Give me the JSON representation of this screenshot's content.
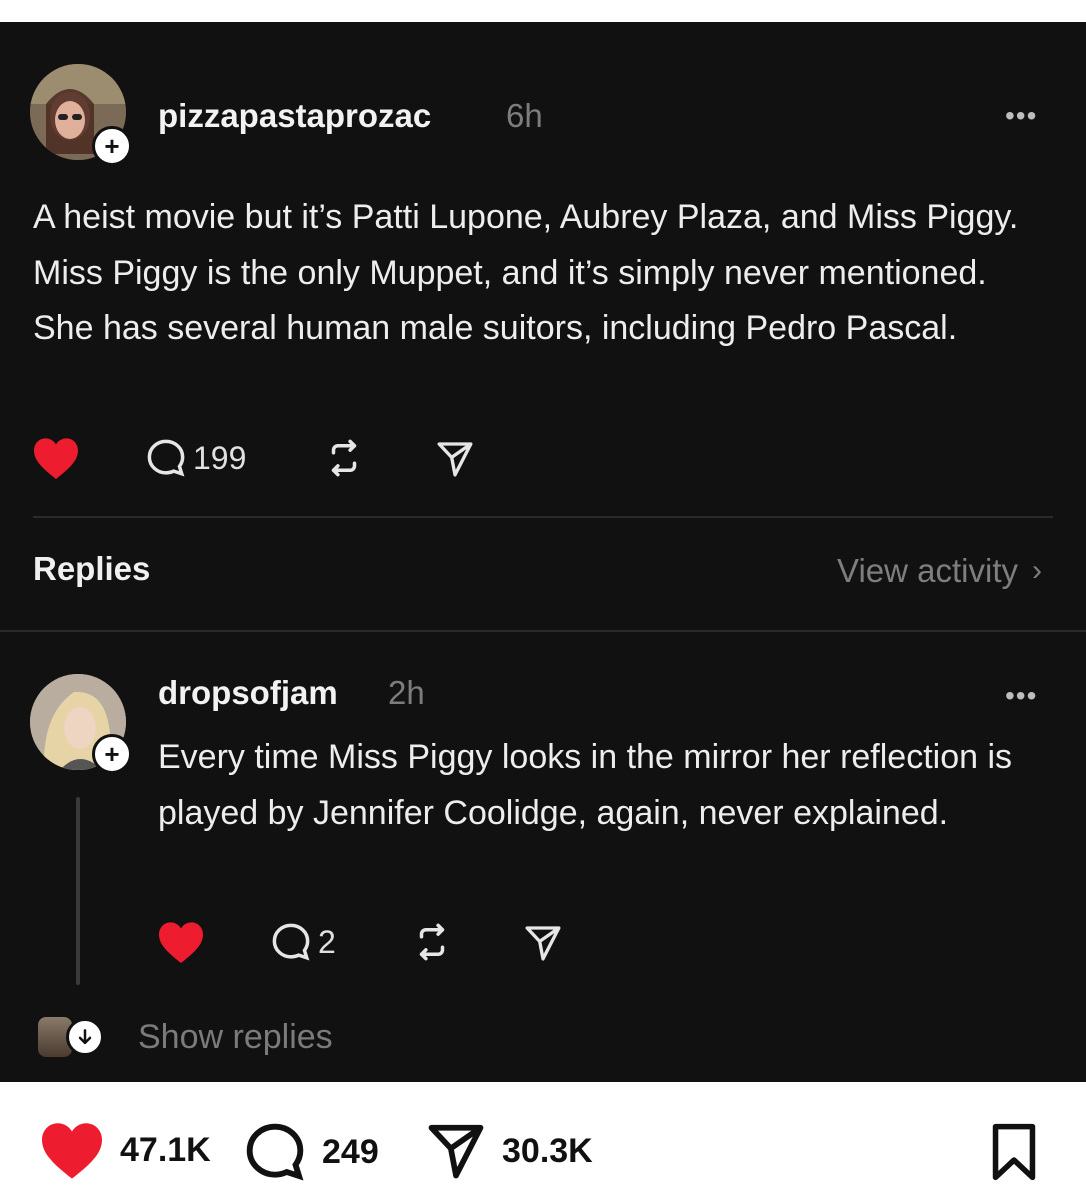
{
  "post": {
    "username": "pizzapastaprozac",
    "time": "6h",
    "text": "A heist movie but it’s Patti Lupone, Aubrey Plaza, and Miss Piggy. Miss Piggy is the only Muppet, and it’s simply never mentioned. She has several human male suitors, including Pedro Pascal.",
    "comment_count": "199",
    "more_label": "•••",
    "follow_glyph": "+",
    "liked": true
  },
  "replies_section": {
    "label": "Replies",
    "view_activity": "View activity",
    "chevron": "›"
  },
  "reply": {
    "username": "dropsofjam",
    "time": "2h",
    "text": "Every time Miss Piggy looks in the mirror her reflection is played by Jennifer Coolidge, again, never explained.",
    "comment_count": "2",
    "more_label": "•••",
    "follow_glyph": "+",
    "liked": true,
    "show_replies": "Show replies"
  },
  "bottom_bar": {
    "likes": "47.1K",
    "comments": "249",
    "shares": "30.3K"
  },
  "colors": {
    "background": "#111111",
    "like_red": "#ed1c2e",
    "muted": "#7d7d7d"
  }
}
